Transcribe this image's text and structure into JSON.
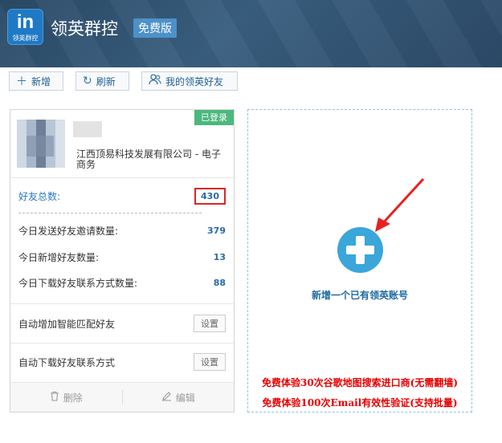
{
  "header": {
    "logo_text": "in",
    "logo_caption": "领英群控",
    "app_title": "领英群控",
    "edition_badge": "免费版"
  },
  "toolbar": {
    "add_label": "新增",
    "refresh_label": "刷新",
    "friends_label": "我的领英好友"
  },
  "account_card": {
    "status_badge": "已登录",
    "company": "江西顶易科技发展有限公司 - 电子商务",
    "friends_total_label": "好友总数:",
    "friends_total_value": "430",
    "stats": [
      {
        "label": "今日发送好友邀请数量:",
        "value": "379"
      },
      {
        "label": "今日新增好友数量:",
        "value": "13"
      },
      {
        "label": "今日下载好友联系方式数量:",
        "value": "88"
      }
    ],
    "settings": [
      {
        "label": "自动增加智能匹配好友",
        "button": "设置"
      },
      {
        "label": "自动下载好友联系方式",
        "button": "设置"
      }
    ],
    "delete_label": "删除",
    "edit_label": "编辑"
  },
  "add_panel": {
    "add_label": "新增一个已有领英账号",
    "promo_1": "免费体验30次谷歌地图搜索进口商(无需翻墙)",
    "promo_2": "免费体验100次Email有效性验证(支持批量)"
  },
  "colors": {
    "header_bg": "#34546f",
    "accent": "#3aa6da",
    "badge_green": "#4cb87d",
    "highlight_red": "#e02424",
    "promo_red": "#e60000"
  }
}
